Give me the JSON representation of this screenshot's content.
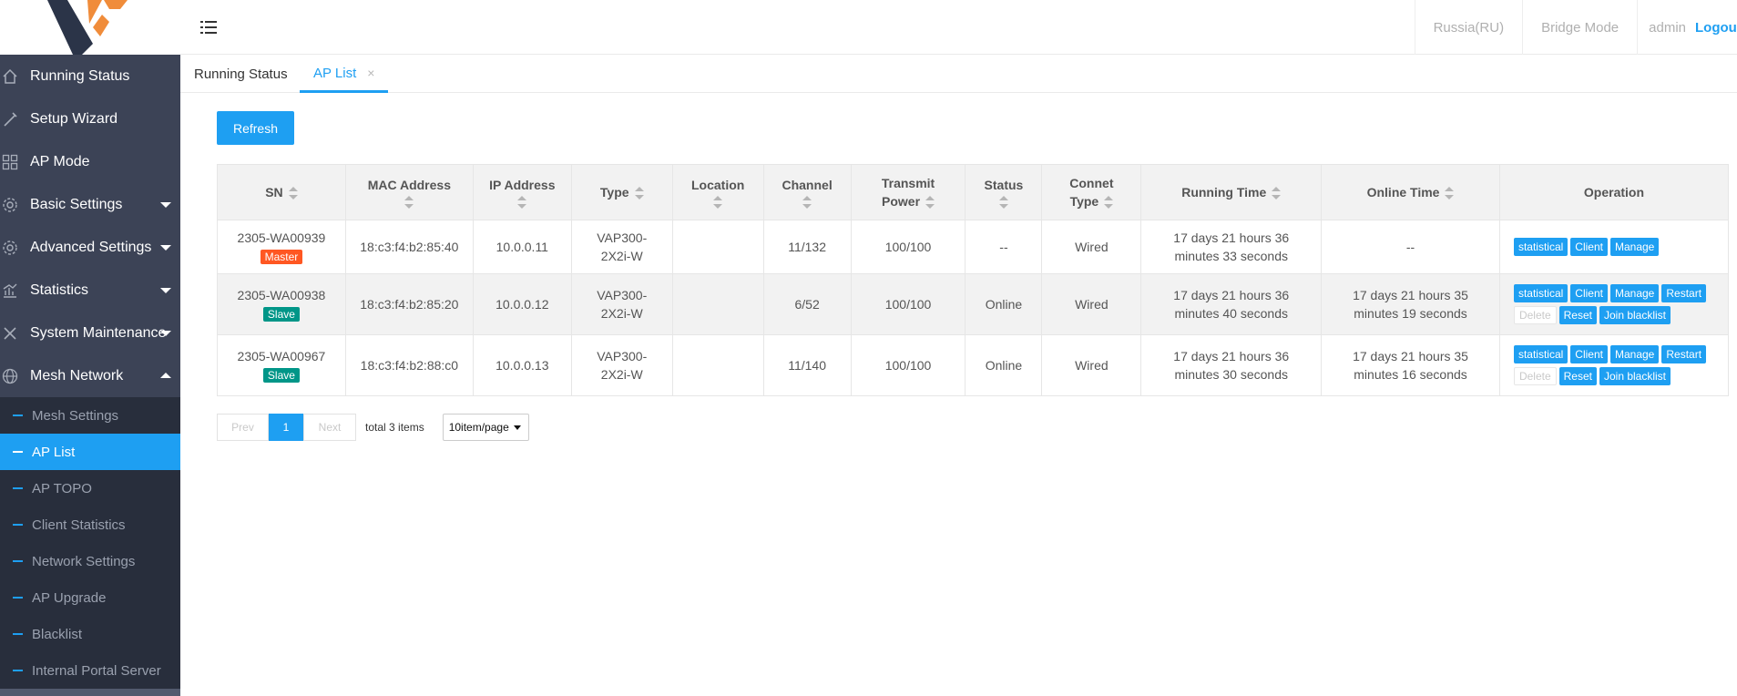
{
  "header": {
    "region": "Russia(RU)",
    "mode": "Bridge Mode",
    "user": "admin",
    "logout": "Logou"
  },
  "sidebar": {
    "items": [
      {
        "label": "Running Status",
        "icon": "home-icon"
      },
      {
        "label": "Setup Wizard",
        "icon": "wand-icon"
      },
      {
        "label": "AP Mode",
        "icon": "grid-icon"
      },
      {
        "label": "Basic Settings",
        "icon": "gear-icon"
      },
      {
        "label": "Advanced Settings",
        "icon": "gear-icon"
      },
      {
        "label": "Statistics",
        "icon": "chart-icon"
      },
      {
        "label": "System Maintenance",
        "icon": "tools-icon"
      },
      {
        "label": "Mesh Network",
        "icon": "globe-icon"
      }
    ],
    "sub_items": [
      {
        "label": "Mesh Settings"
      },
      {
        "label": "AP List"
      },
      {
        "label": "AP TOPO"
      },
      {
        "label": "Client Statistics"
      },
      {
        "label": "Network Settings"
      },
      {
        "label": "AP Upgrade"
      },
      {
        "label": "Blacklist"
      },
      {
        "label": "Internal Portal Server"
      }
    ]
  },
  "tabs": [
    {
      "label": "Running Status"
    },
    {
      "label": "AP List",
      "close": "×"
    }
  ],
  "toolbar": {
    "refresh": "Refresh"
  },
  "table": {
    "headers": {
      "sn": "SN",
      "mac": "MAC Address",
      "ip": "IP Address",
      "type": "Type",
      "location": "Location",
      "channel": "Channel",
      "power_1": "Transmit",
      "power_2": "Power",
      "status": "Status",
      "conn_1": "Connet",
      "conn_2": "Type",
      "running": "Running Time",
      "online": "Online Time",
      "operation": "Operation"
    },
    "rows": [
      {
        "sn": "2305-WA00939",
        "role": "Master",
        "mac": "18:c3:f4:b2:85:40",
        "ip": "10.0.0.11",
        "type_1": "VAP300-",
        "type_2": "2X2i-W",
        "location": "",
        "channel": "11/132",
        "power": "100/100",
        "status": "--",
        "conn": "Wired",
        "running_1": "17 days 21 hours 36",
        "running_2": "minutes 33 seconds",
        "online": "--"
      },
      {
        "sn": "2305-WA00938",
        "role": "Slave",
        "mac": "18:c3:f4:b2:85:20",
        "ip": "10.0.0.12",
        "type_1": "VAP300-",
        "type_2": "2X2i-W",
        "location": "",
        "channel": "6/52",
        "power": "100/100",
        "status": "Online",
        "conn": "Wired",
        "running_1": "17 days 21 hours 36",
        "running_2": "minutes 40 seconds",
        "online_1": "17 days 21 hours 35",
        "online_2": "minutes 19 seconds"
      },
      {
        "sn": "2305-WA00967",
        "role": "Slave",
        "mac": "18:c3:f4:b2:88:c0",
        "ip": "10.0.0.13",
        "type_1": "VAP300-",
        "type_2": "2X2i-W",
        "location": "",
        "channel": "11/140",
        "power": "100/100",
        "status": "Online",
        "conn": "Wired",
        "running_1": "17 days 21 hours 36",
        "running_2": "minutes 30 seconds",
        "online_1": "17 days 21 hours 35",
        "online_2": "minutes 16 seconds"
      }
    ],
    "ops": {
      "statistical": "statistical",
      "client": "Client",
      "manage": "Manage",
      "restart": "Restart",
      "delete": "Delete",
      "reset": "Reset",
      "blacklist": "Join blacklist"
    }
  },
  "pagination": {
    "prev": "Prev",
    "page": "1",
    "next": "Next",
    "total": "total 3 items",
    "per_page": "10item/page"
  },
  "colors": {
    "accent": "#1e9ff2",
    "sidebar": "#3c4356",
    "master_badge": "#ff5722",
    "slave_badge": "#009688"
  }
}
